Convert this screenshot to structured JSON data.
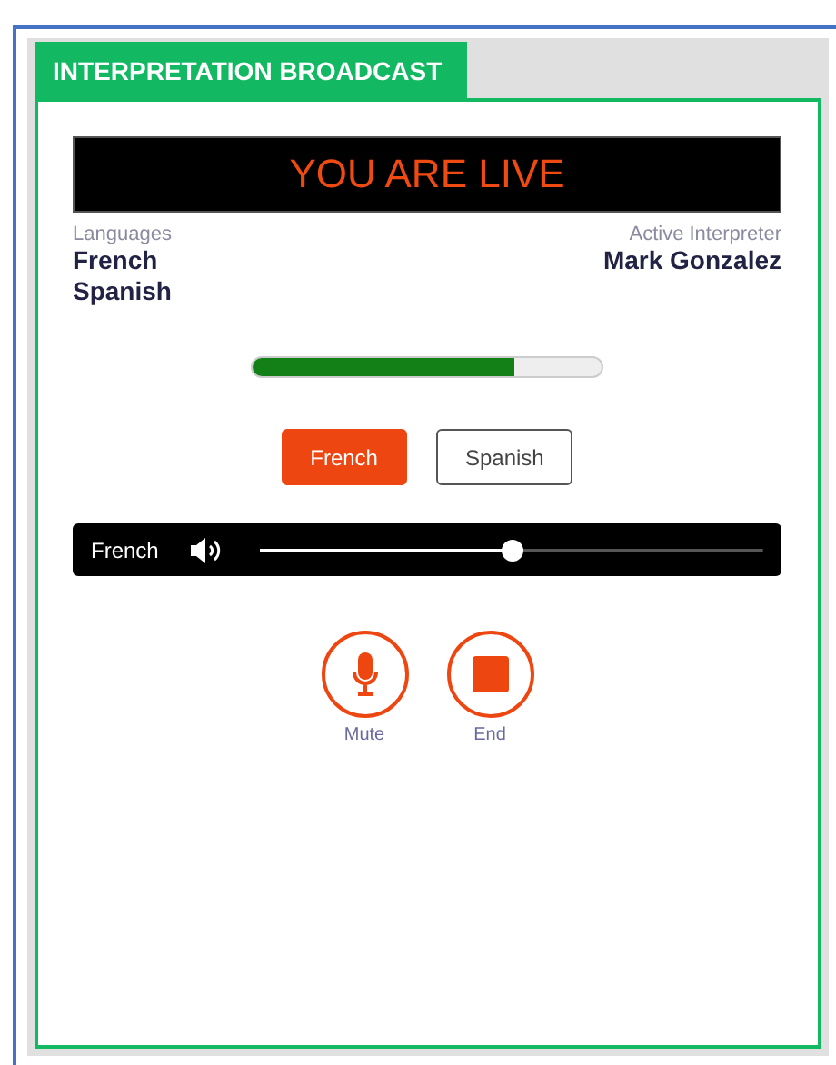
{
  "tab": {
    "label": "INTERPRETATION BROADCAST",
    "selected": true
  },
  "live_banner": "YOU ARE LIVE",
  "languages": {
    "label": "Languages",
    "items": [
      "French",
      "Spanish"
    ]
  },
  "interpreter": {
    "label": "Active Interpreter",
    "name": "Mark Gonzalez"
  },
  "progress": {
    "level": 0.75
  },
  "language_buttons": [
    {
      "label": "French",
      "selected": true
    },
    {
      "label": "Spanish",
      "selected": false
    }
  ],
  "player": {
    "label": "French",
    "level": 0.5
  },
  "actions": [
    {
      "kind": "mute",
      "label": "Mute"
    },
    {
      "kind": "end",
      "label": "End"
    }
  ]
}
